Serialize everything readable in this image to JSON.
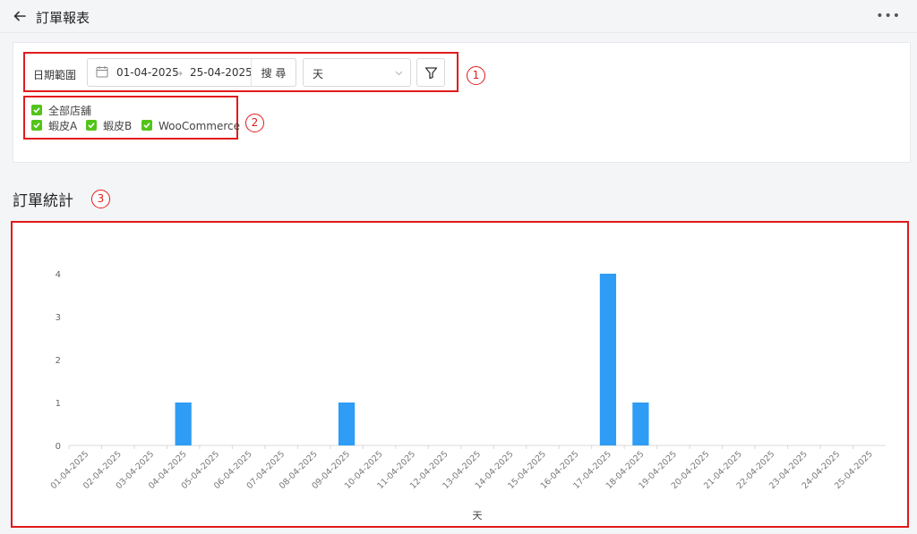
{
  "header": {
    "title": "訂單報表",
    "more_label": "•••"
  },
  "filters": {
    "date_label": "日期範圍",
    "start_date": "01-04-2025",
    "end_date": "25-04-2025",
    "range_separator": "→",
    "search_label": "搜 尋",
    "unit_value": "天"
  },
  "stores": {
    "all_label": "全部店舖",
    "items": [
      {
        "label": "蝦皮A",
        "checked": true
      },
      {
        "label": "蝦皮B",
        "checked": true
      },
      {
        "label": "WooCommerce",
        "checked": true
      }
    ]
  },
  "annotations": [
    "1",
    "2",
    "3"
  ],
  "section_title": "訂單統計",
  "colors": {
    "bar": "#2f9cf5",
    "highlight": "#e21a1a",
    "checkbox": "#52c41a"
  },
  "chart_data": {
    "type": "bar",
    "xlabel": "天",
    "ylabel": "",
    "ylim": [
      0,
      4
    ],
    "yticks": [
      0,
      1,
      2,
      3,
      4
    ],
    "grid": false,
    "categories": [
      "01-04-2025",
      "02-04-2025",
      "03-04-2025",
      "04-04-2025",
      "05-04-2025",
      "06-04-2025",
      "07-04-2025",
      "08-04-2025",
      "09-04-2025",
      "10-04-2025",
      "11-04-2025",
      "12-04-2025",
      "13-04-2025",
      "14-04-2025",
      "15-04-2025",
      "16-04-2025",
      "17-04-2025",
      "18-04-2025",
      "19-04-2025",
      "20-04-2025",
      "21-04-2025",
      "22-04-2025",
      "23-04-2025",
      "24-04-2025",
      "25-04-2025"
    ],
    "values": [
      0,
      0,
      0,
      1,
      0,
      0,
      0,
      0,
      1,
      0,
      0,
      0,
      0,
      0,
      0,
      0,
      4,
      1,
      0,
      0,
      0,
      0,
      0,
      0,
      0
    ]
  }
}
